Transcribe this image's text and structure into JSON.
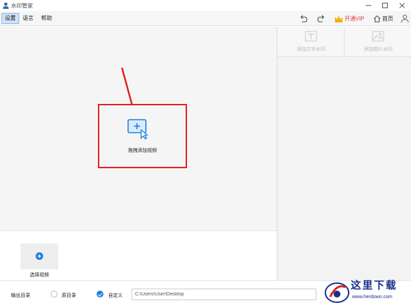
{
  "window": {
    "title": "水印管家"
  },
  "menu": {
    "settings": "设置",
    "language": "语言",
    "help": "帮助"
  },
  "toolbar": {
    "vip_label": "开通VIP",
    "home_label": "首页"
  },
  "canvas": {
    "drop_label": "拖拽添加视频"
  },
  "right_panel": {
    "add_text_watermark": "添加文字水印",
    "add_image_watermark": "添加图片水印"
  },
  "video_area": {
    "select_video": "选择视频"
  },
  "output": {
    "label": "输出目录",
    "option_original": "原目录",
    "option_custom": "自定义",
    "selected": "自定义",
    "path_value": "C:\\Users\\User\\Desktop"
  },
  "watermark": {
    "text": "这里下载",
    "url": "www.herdown.com"
  },
  "colors": {
    "accent": "#1e7fe0",
    "highlight_red": "#e02020",
    "vip_red": "#e8383d"
  },
  "icons": [
    "app-logo-icon",
    "minimize-icon",
    "maximize-icon",
    "close-icon",
    "undo-icon",
    "redo-icon",
    "crown-icon",
    "home-icon",
    "user-icon",
    "add-video-icon",
    "text-watermark-icon",
    "image-watermark-icon",
    "plus-icon"
  ]
}
